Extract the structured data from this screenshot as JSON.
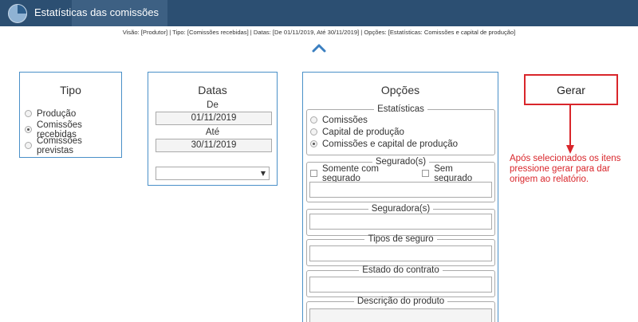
{
  "header": {
    "title": "Estatísticas das comissões"
  },
  "summary": "Visão: [Produtor] | Tipo: [Comissões recebidas] | Datas: [De 01/11/2019, Até 30/11/2019] | Opções: [Estatísticas: Comissões e capital de produção]",
  "tipo": {
    "title": "Tipo",
    "options": [
      "Produção",
      "Comissões recebidas",
      "Comissões previstas"
    ],
    "selected_index": 1
  },
  "datas": {
    "title": "Datas",
    "from_label": "De",
    "from_value": "01/11/2019",
    "to_label": "Até",
    "to_value": "30/11/2019",
    "select_value": ""
  },
  "opcoes": {
    "title": "Opções",
    "estatisticas": {
      "legend": "Estatísticas",
      "options": [
        "Comissões",
        "Capital de produção",
        "Comissões e capital de produção"
      ],
      "selected_index": 2
    },
    "segurados": {
      "legend": "Segurado(s)",
      "check_with": "Somente com segurado",
      "check_without": "Sem segurado"
    },
    "seguradoras": {
      "legend": "Seguradora(s)"
    },
    "tipos_seguro": {
      "legend": "Tipos de seguro"
    },
    "estado_contrato": {
      "legend": "Estado do contrato"
    },
    "descricao_produto": {
      "legend": "Descrição do produto"
    }
  },
  "gerar": {
    "label": "Gerar",
    "hint": "Após selecionados os itens pressione gerar para dar origem ao relatório."
  },
  "colors": {
    "header": "#2c4f72",
    "panel_border": "#4a90c8",
    "accent_red": "#d9262b"
  }
}
